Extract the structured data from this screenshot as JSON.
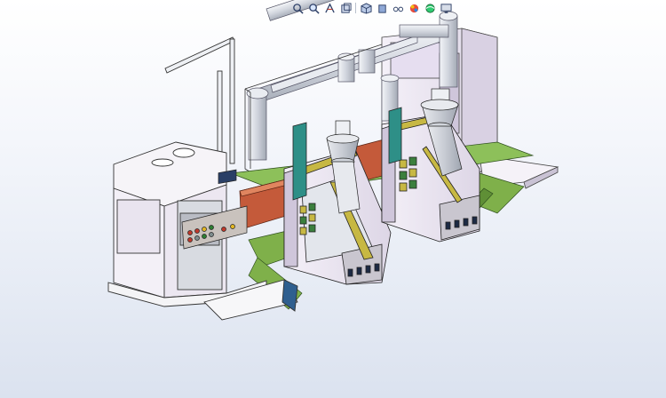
{
  "app": {
    "name": "3D CAD viewport"
  },
  "heads_up_toolbar": {
    "buttons": [
      {
        "id": "zoom-to-fit",
        "icon": "magnify-fit-icon"
      },
      {
        "id": "zoom-to-area",
        "icon": "magnify-area-icon"
      },
      {
        "id": "previous-view",
        "icon": "previous-view-icon"
      },
      {
        "id": "section-view",
        "icon": "section-view-icon"
      },
      {
        "id": "view-orientation",
        "icon": "cube-orientation-icon"
      },
      {
        "id": "display-style",
        "icon": "display-style-icon"
      },
      {
        "id": "hide-show-items",
        "icon": "eye-glasses-icon"
      },
      {
        "id": "edit-appearance",
        "icon": "appearance-sphere-icon"
      },
      {
        "id": "apply-scene",
        "icon": "scene-icon"
      },
      {
        "id": "view-settings",
        "icon": "monitor-icon"
      }
    ]
  },
  "colors": {
    "background_top": "#ffffff",
    "background_bottom": "#dbe2ef",
    "machine_body": "#efe9f5",
    "ductwork": "#d6dae2",
    "base_green": "#7fb04a",
    "conveyor_red": "#c45a3a",
    "frame_yellow": "#c7b843",
    "panel_gray": "#b9bcc4"
  }
}
